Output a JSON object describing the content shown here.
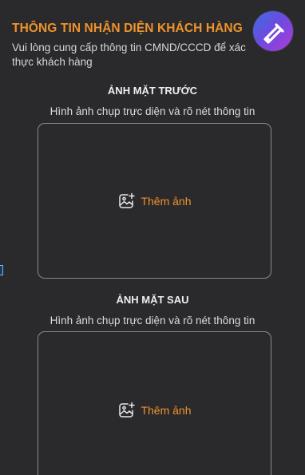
{
  "header": {
    "title": "THÔNG TIN NHẬN DIỆN KHÁCH HÀNG",
    "subtitle": "Vui lòng cung cấp thông tin CMND/CCCD để xác thực khách hàng"
  },
  "front": {
    "heading": "ẢNH MẶT TRƯỚC",
    "caption": "Hình ảnh chụp trực diện và rõ nét thông tin",
    "add_label": "Thêm ảnh",
    "icon": "add-photo-icon"
  },
  "back": {
    "heading": "ẢNH MẶT SAU",
    "caption": "Hình ảnh chụp trực diện và rõ nét thông tin",
    "add_label": "Thêm ảnh",
    "icon": "add-photo-icon"
  },
  "badge": {
    "icon": "pen-app-icon"
  },
  "colors": {
    "accent": "#f0932b",
    "background": "#2a2a2c",
    "border": "#8a8a8c"
  }
}
